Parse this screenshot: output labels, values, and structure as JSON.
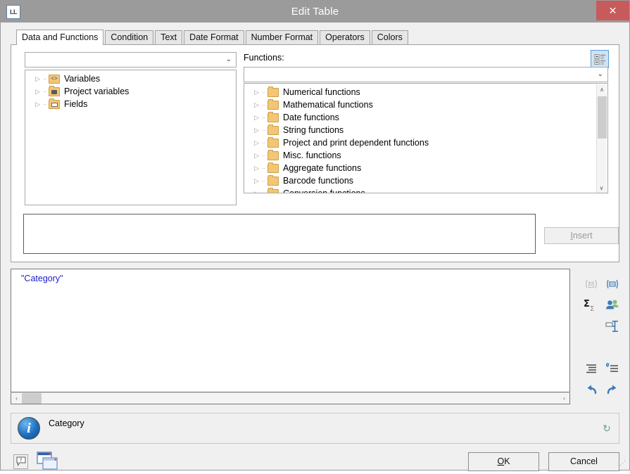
{
  "window": {
    "title": "Edit Table",
    "app_icon_label": "LL",
    "close_label": "✕"
  },
  "tabs": [
    {
      "label": "Data and Functions",
      "active": true
    },
    {
      "label": "Condition",
      "active": false
    },
    {
      "label": "Text",
      "active": false
    },
    {
      "label": "Date Format",
      "active": false
    },
    {
      "label": "Number Format",
      "active": false
    },
    {
      "label": "Operators",
      "active": false
    },
    {
      "label": "Colors",
      "active": false
    }
  ],
  "left_panel": {
    "combo_value": "",
    "combo_chevron": "⌄",
    "tree": [
      {
        "label": "Variables",
        "icon": "variables-folder-icon",
        "expander": "▷"
      },
      {
        "label": "Project variables",
        "icon": "project-variables-folder-icon",
        "expander": "▷"
      },
      {
        "label": "Fields",
        "icon": "fields-folder-icon",
        "expander": "▷"
      }
    ]
  },
  "right_panel": {
    "functions_label": "Functions:",
    "combo_value": "",
    "combo_chevron": "⌄",
    "grid_toggle_name": "grouped-list-toggle",
    "tree": [
      {
        "label": "Numerical functions",
        "icon": "folder-icon",
        "expander": "▷"
      },
      {
        "label": "Mathematical functions",
        "icon": "folder-icon",
        "expander": "▷"
      },
      {
        "label": "Date functions",
        "icon": "folder-icon",
        "expander": "▷"
      },
      {
        "label": "String functions",
        "icon": "folder-icon",
        "expander": "▷"
      },
      {
        "label": "Project and print dependent functions",
        "icon": "folder-icon",
        "expander": "▷"
      },
      {
        "label": "Misc. functions",
        "icon": "folder-icon",
        "expander": "▷"
      },
      {
        "label": "Aggregate functions",
        "icon": "folder-icon",
        "expander": "▷"
      },
      {
        "label": "Barcode functions",
        "icon": "folder-icon",
        "expander": "▷"
      },
      {
        "label": "Conversion functions",
        "icon": "folder-icon",
        "expander": "▷"
      }
    ],
    "scroll_up": "∧",
    "scroll_down": "∨"
  },
  "preview": {
    "text": ""
  },
  "insert_button": {
    "prefix": "",
    "accel": "I",
    "suffix": "nsert",
    "enabled": false
  },
  "expression": {
    "text": "\"Category\"",
    "scroll_left": "‹",
    "scroll_right": "›"
  },
  "editor_tools": [
    {
      "name": "insert-variable-icon",
      "glyph": "⇔",
      "enabled": false
    },
    {
      "name": "insert-text-icon",
      "glyph": "▭",
      "enabled": true
    },
    {
      "name": "sum-aggregate-icon",
      "glyph": "Σ",
      "enabled": true
    },
    {
      "name": "users-group-icon",
      "glyph": "●●",
      "enabled": true
    },
    {
      "name": "paragraph-properties-icon",
      "glyph": "≡",
      "enabled": true
    },
    {
      "name": "indent-icon",
      "glyph": "≡",
      "enabled": true
    },
    {
      "name": "unindent-icon",
      "glyph": "↶≡",
      "enabled": true
    },
    {
      "name": "undo-icon",
      "glyph": "↶",
      "enabled": true
    },
    {
      "name": "redo-icon",
      "glyph": "↷",
      "enabled": true
    }
  ],
  "info_bar": {
    "icon_glyph": "i",
    "text": "Category",
    "refresh_glyph": "↻"
  },
  "bottom_bar": {
    "help_glyph": "?",
    "windows_icon_name": "cascade-windows-icon",
    "ok": {
      "prefix": "",
      "accel": "O",
      "suffix": "K"
    },
    "cancel": {
      "label": "Cancel"
    }
  },
  "colors": {
    "titlebar": "#9b9b9b",
    "close_button": "#c75b5b",
    "accent_blue": "#3d7ab8",
    "expression_text": "#1e1ec8",
    "folder": "#f2c675",
    "grid_toggle_bg": "#cde3f7"
  }
}
